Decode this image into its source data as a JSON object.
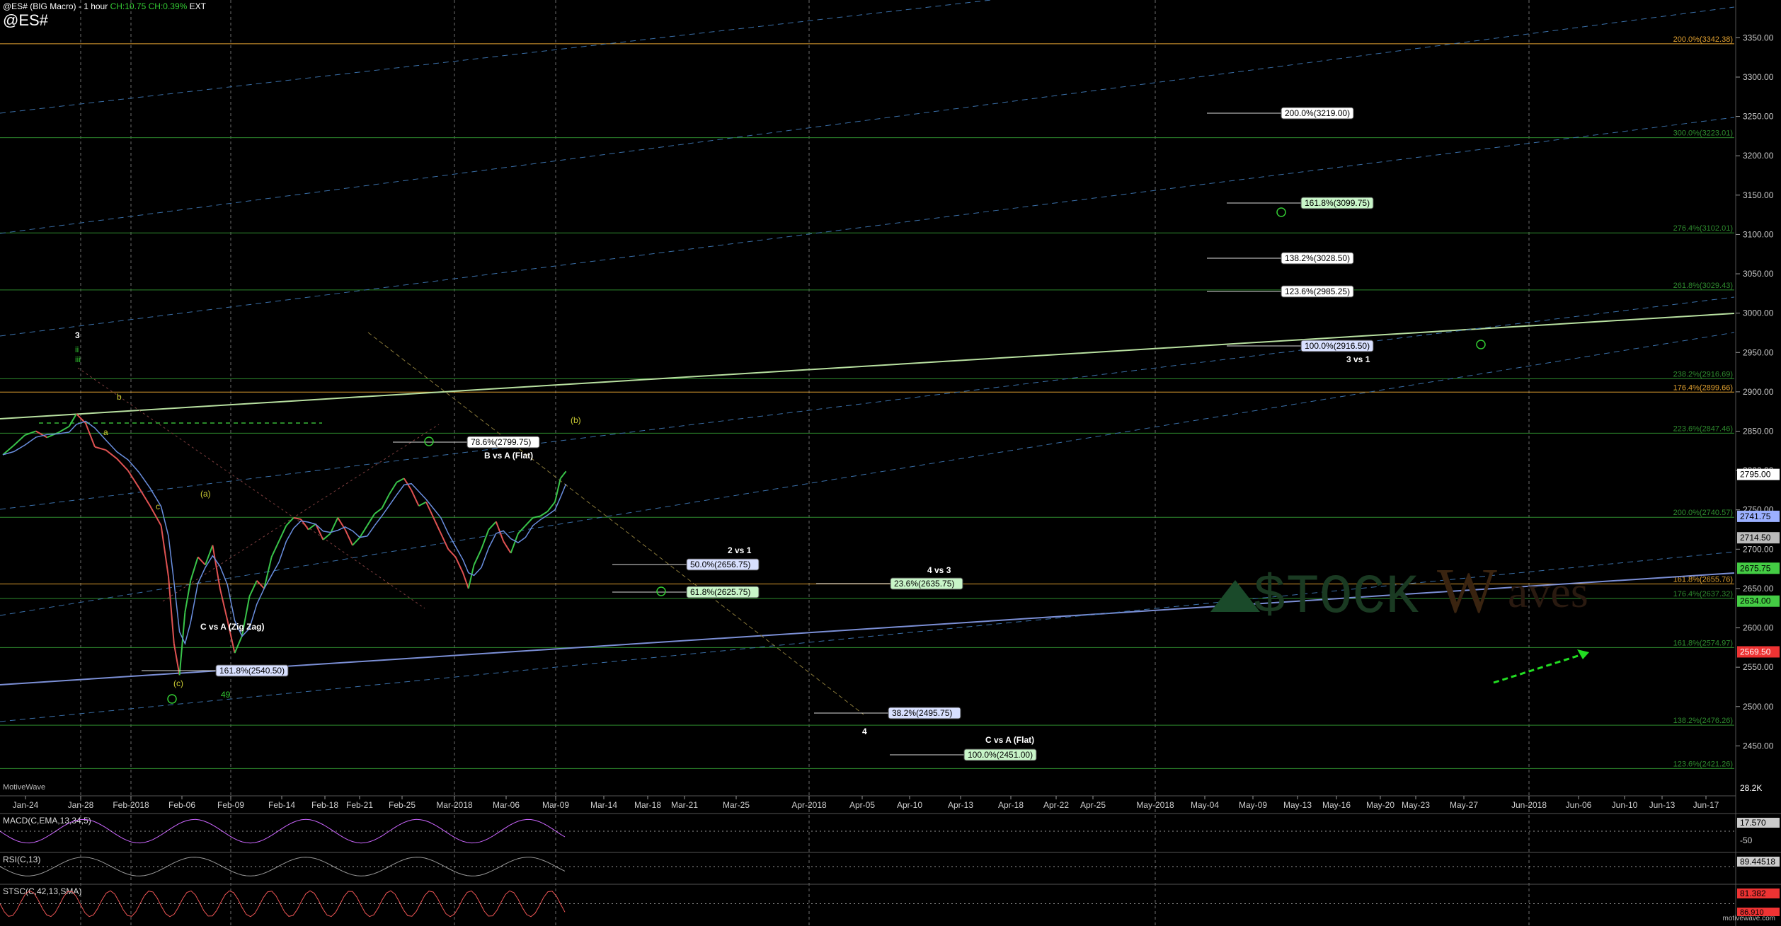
{
  "header": {
    "title": "@ES# (BIG Macro) - 1 hour",
    "change_abs": "CH:10.75",
    "change_pct": "CH:0.39%",
    "session": "EXT",
    "symbol": "@ES#"
  },
  "watermark": {
    "brand": "MotiveWave",
    "logo": "STOCK Waves",
    "footer": "motivewave.com"
  },
  "colors": {
    "background": "#000000",
    "grid": "#8a8a8a",
    "fib_green": "#2e8b2e",
    "fib_orange": "#e0a030",
    "price_bull": "#39c44a",
    "price_bear": "#e05252",
    "trend_blue": "#7b8fd6",
    "trend_lightgreen": "#b8e0a0",
    "projection_arrow": "#22dd22",
    "label_box_bg": "#ffffff",
    "label_box_green": "#c8f5c8",
    "label_box_blue": "#d8e0ff"
  },
  "chart_data": {
    "type": "line",
    "ylim": [
      2400,
      3380
    ],
    "y_ticks": [
      2450,
      2500,
      2550,
      2600,
      2650,
      2700,
      2750,
      2800,
      2850,
      2900,
      2950,
      3000,
      3050,
      3100,
      3150,
      3200,
      3250,
      3300,
      3350
    ],
    "x_tick_labels": [
      "Jan-24",
      "Jan-28",
      "Feb-2018",
      "Feb-06",
      "Feb-09",
      "Feb-14",
      "Feb-18",
      "Feb-21",
      "Feb-25",
      "Mar-2018",
      "Mar-06",
      "Mar-09",
      "Mar-14",
      "Mar-18",
      "Mar-21",
      "Mar-25",
      "Apr-2018",
      "Apr-05",
      "Apr-10",
      "Apr-13",
      "Apr-18",
      "Apr-22",
      "Apr-25",
      "May-2018",
      "May-04",
      "May-09",
      "May-13",
      "May-16",
      "May-20",
      "May-23",
      "May-27",
      "Jun-2018",
      "Jun-06",
      "Jun-10",
      "Jun-13",
      "Jun-17"
    ],
    "price_series": {
      "name": "@ES#",
      "points": [
        [
          0,
          2820
        ],
        [
          0.6,
          2832
        ],
        [
          1.2,
          2845
        ],
        [
          1.8,
          2850
        ],
        [
          2.4,
          2842
        ],
        [
          3.0,
          2848
        ],
        [
          3.6,
          2856
        ],
        [
          4.0,
          2872
        ],
        [
          4.5,
          2860
        ],
        [
          5.0,
          2830
        ],
        [
          5.6,
          2826
        ],
        [
          6.2,
          2815
        ],
        [
          6.8,
          2800
        ],
        [
          7.4,
          2778
        ],
        [
          8.0,
          2755
        ],
        [
          8.6,
          2730
        ],
        [
          9.0,
          2665
        ],
        [
          9.3,
          2580
        ],
        [
          9.6,
          2540
        ],
        [
          9.9,
          2620
        ],
        [
          10.2,
          2660
        ],
        [
          10.6,
          2690
        ],
        [
          11.0,
          2680
        ],
        [
          11.4,
          2705
        ],
        [
          11.8,
          2650
        ],
        [
          12.2,
          2610
        ],
        [
          12.6,
          2568
        ],
        [
          13.0,
          2590
        ],
        [
          13.4,
          2640
        ],
        [
          13.8,
          2660
        ],
        [
          14.2,
          2650
        ],
        [
          14.6,
          2690
        ],
        [
          15.0,
          2710
        ],
        [
          15.4,
          2730
        ],
        [
          15.8,
          2740
        ],
        [
          16.2,
          2738
        ],
        [
          16.6,
          2725
        ],
        [
          17.0,
          2732
        ],
        [
          17.4,
          2712
        ],
        [
          17.8,
          2720
        ],
        [
          18.2,
          2740
        ],
        [
          18.6,
          2725
        ],
        [
          19.0,
          2705
        ],
        [
          19.4,
          2715
        ],
        [
          19.8,
          2730
        ],
        [
          20.2,
          2745
        ],
        [
          20.6,
          2752
        ],
        [
          21.0,
          2770
        ],
        [
          21.4,
          2785
        ],
        [
          21.8,
          2790
        ],
        [
          22.2,
          2775
        ],
        [
          22.6,
          2755
        ],
        [
          23.0,
          2760
        ],
        [
          23.4,
          2740
        ],
        [
          23.8,
          2720
        ],
        [
          24.2,
          2700
        ],
        [
          24.6,
          2690
        ],
        [
          25.0,
          2670
        ],
        [
          25.3,
          2650
        ],
        [
          25.6,
          2680
        ],
        [
          26.0,
          2700
        ],
        [
          26.4,
          2725
        ],
        [
          26.8,
          2735
        ],
        [
          27.2,
          2710
        ],
        [
          27.6,
          2695
        ],
        [
          28.0,
          2720
        ],
        [
          28.4,
          2730
        ],
        [
          28.8,
          2740
        ],
        [
          29.2,
          2742
        ],
        [
          29.6,
          2748
        ],
        [
          30.0,
          2760
        ],
        [
          30.3,
          2790
        ],
        [
          30.6,
          2799
        ]
      ],
      "last_price": 2795.0
    },
    "fib_levels_right": [
      {
        "label": "200.0%(3342.38)",
        "value": 3342.38,
        "color": "orange"
      },
      {
        "label": "300.0%(3223.01)",
        "value": 3223.01,
        "color": "green"
      },
      {
        "label": "276.4%(3102.01)",
        "value": 3102.01,
        "color": "green"
      },
      {
        "label": "261.8%(3029.43)",
        "value": 3029.43,
        "color": "green"
      },
      {
        "label": "238.2%(2916.69)",
        "value": 2916.69,
        "color": "green"
      },
      {
        "label": "176.4%(2899.66)",
        "value": 2899.66,
        "color": "orange"
      },
      {
        "label": "223.6%(2847.46)",
        "value": 2847.46,
        "color": "green"
      },
      {
        "label": "200.0%(2740.57)",
        "value": 2740.57,
        "color": "green"
      },
      {
        "label": "161.8%(2655.76)",
        "value": 2655.76,
        "color": "orange"
      },
      {
        "label": "176.4%(2637.32)",
        "value": 2637.32,
        "color": "green"
      },
      {
        "label": "161.8%(2574.97)",
        "value": 2574.97,
        "color": "green"
      },
      {
        "label": "138.2%(2476.26)",
        "value": 2476.26,
        "color": "green"
      },
      {
        "label": "123.6%(2421.26)",
        "value": 2421.26,
        "color": "green"
      }
    ],
    "target_boxes": [
      {
        "label": "200.0%(3219.00)",
        "value": 3219.0,
        "style": "white"
      },
      {
        "label": "161.8%(3099.75)",
        "value": 3099.75,
        "style": "green"
      },
      {
        "label": "138.2%(3028.50)",
        "value": 3028.5,
        "style": "white"
      },
      {
        "label": "123.6%(2985.25)",
        "value": 2985.25,
        "style": "white"
      },
      {
        "label": "100.0%(2916.50)",
        "value": 2916.5,
        "style": "blue"
      },
      {
        "label": "78.6%(2799.75)",
        "value": 2799.75,
        "style": "white"
      },
      {
        "label": "50.0%(2656.75)",
        "value": 2656.75,
        "style": "blue"
      },
      {
        "label": "61.8%(2625.75)",
        "value": 2625.75,
        "style": "green"
      },
      {
        "label": "23.6%(2635.75)",
        "value": 2635.75,
        "style": "green"
      },
      {
        "label": "38.2%(2495.75)",
        "value": 2495.75,
        "style": "blue"
      },
      {
        "label": "100.0%(2451.00)",
        "value": 2451.0,
        "style": "green"
      },
      {
        "label": "161.8%(2540.50)",
        "value": 2540.5,
        "style": "blue"
      }
    ],
    "annotations": [
      "B vs A (Flat)",
      "C vs A (Zig Zag)",
      "2 vs 1",
      "4 vs 3",
      "3 vs 1",
      "C vs A (Flat)",
      "3",
      "4",
      "(b)",
      "(c)",
      "(a)",
      "b",
      "a",
      "c",
      "ii",
      "iii",
      "49"
    ],
    "right_price_tags": [
      {
        "label": "2795.00",
        "value": 2795.0,
        "color": "white"
      },
      {
        "label": "2741.75",
        "value": 2741.75,
        "color": "blue"
      },
      {
        "label": "2714.50",
        "value": 2714.5,
        "color": "gray"
      },
      {
        "label": "2675.75",
        "value": 2675.75,
        "color": "green"
      },
      {
        "label": "2634.00",
        "value": 2634.0,
        "color": "green"
      },
      {
        "label": "2569.50",
        "value": 2569.5,
        "color": "red"
      }
    ],
    "volume_tag": "28.2K",
    "indicators": [
      {
        "name": "MACD(C,EMA,13,34,5)",
        "value": "17.570",
        "zero_label": "-50"
      },
      {
        "name": "RSI(C,13)",
        "value": "89.44518"
      },
      {
        "name": "STSC(C,42,13,SMA)",
        "value": "81.382",
        "value2": "86.910"
      }
    ]
  }
}
